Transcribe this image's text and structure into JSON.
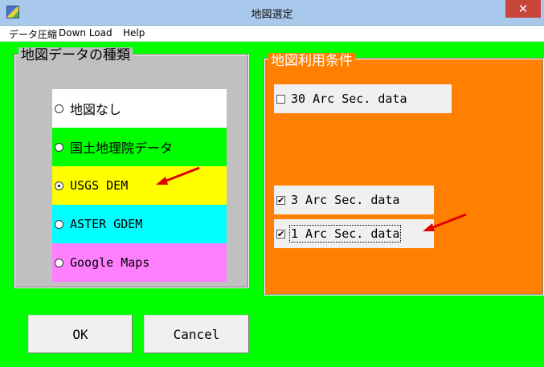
{
  "window": {
    "title": "地図選定",
    "close_glyph": "✕"
  },
  "menu": [
    "データ圧縮",
    "Down Load",
    "Help"
  ],
  "map_kind": {
    "title": "地図データの種類",
    "options": [
      {
        "label": "地図なし",
        "color": "#ffffff",
        "selected": false
      },
      {
        "label": "国土地理院データ",
        "color": "#00ff00",
        "selected": false
      },
      {
        "label": "USGS DEM",
        "color": "#ffff00",
        "selected": true
      },
      {
        "label": "ASTER GDEM",
        "color": "#00ffff",
        "selected": false
      },
      {
        "label": "Google Maps",
        "color": "#ff80ff",
        "selected": false
      }
    ]
  },
  "conditions": {
    "title": "地図利用条件",
    "options": [
      {
        "label": "30 Arc Sec. data",
        "checked": false
      },
      {
        "label": "3 Arc Sec. data",
        "checked": true
      },
      {
        "label": "1 Arc Sec. data",
        "checked": true
      }
    ]
  },
  "buttons": {
    "ok": "OK",
    "cancel": "Cancel"
  },
  "colors": {
    "background": "#00ff00",
    "conditions_panel": "#ff8000",
    "annotation_arrow": "#e00000"
  }
}
